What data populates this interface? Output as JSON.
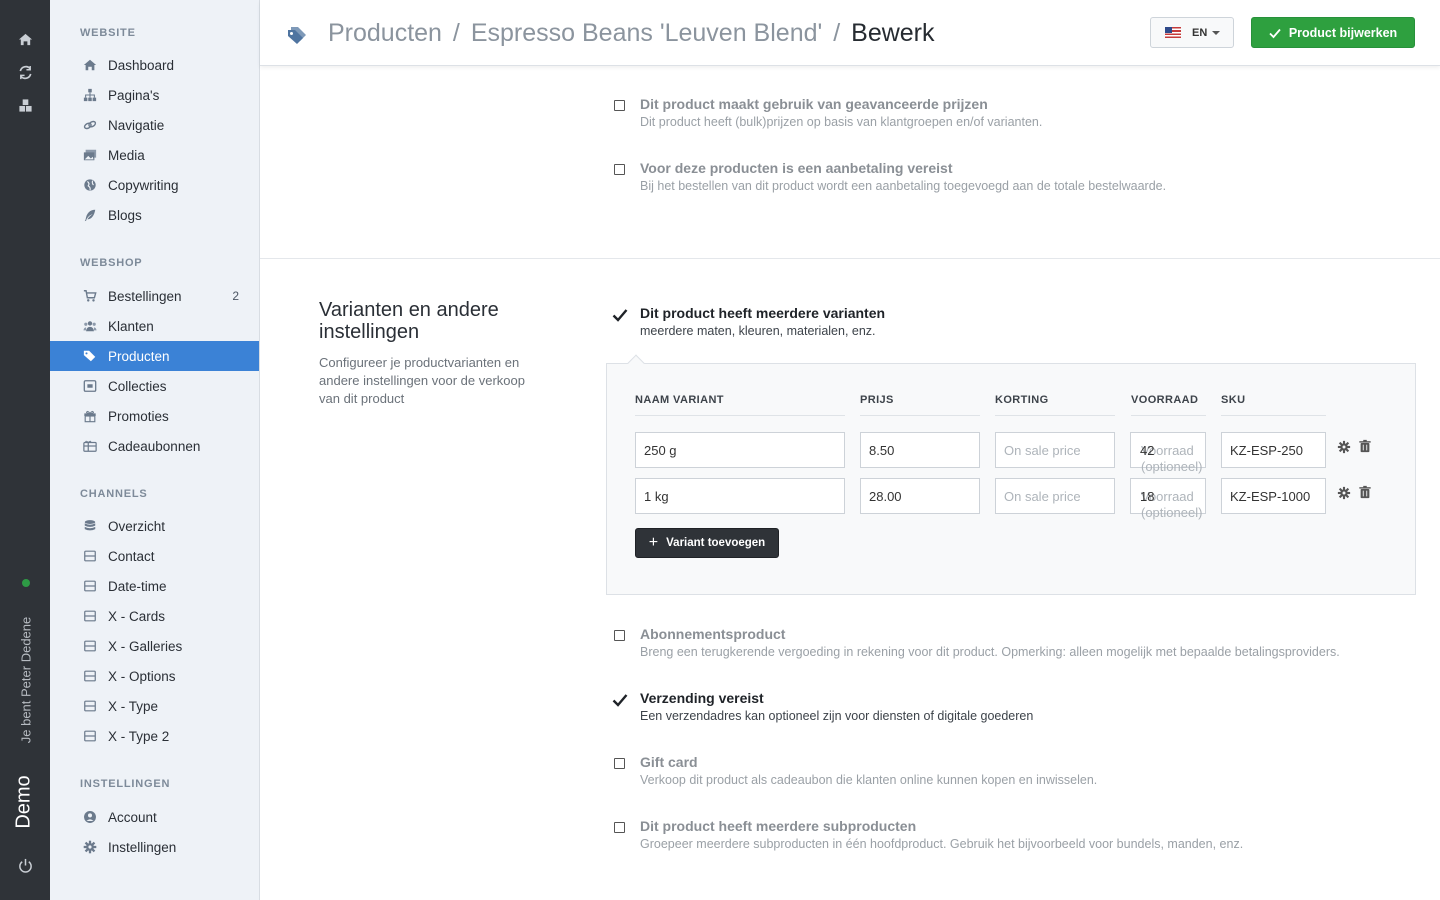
{
  "rail": {
    "user_label": "Je bent Peter Dedene",
    "brand": "Demo"
  },
  "sidebar": {
    "sections": [
      {
        "title": "WEBSITE",
        "items": [
          {
            "label": "Dashboard",
            "icon": "home-icon"
          },
          {
            "label": "Pagina's",
            "icon": "sitemap-icon"
          },
          {
            "label": "Navigatie",
            "icon": "link-icon"
          },
          {
            "label": "Media",
            "icon": "images-icon"
          },
          {
            "label": "Copywriting",
            "icon": "globe-icon"
          },
          {
            "label": "Blogs",
            "icon": "feather-icon"
          }
        ]
      },
      {
        "title": "WEBSHOP",
        "items": [
          {
            "label": "Bestellingen",
            "icon": "cart-icon",
            "badge": "2"
          },
          {
            "label": "Klanten",
            "icon": "users-icon"
          },
          {
            "label": "Producten",
            "icon": "tags-icon",
            "active": true
          },
          {
            "label": "Collecties",
            "icon": "collection-icon"
          },
          {
            "label": "Promoties",
            "icon": "gift-icon"
          },
          {
            "label": "Cadeaubonnen",
            "icon": "giftcard-icon"
          }
        ]
      },
      {
        "title": "CHANNELS",
        "items": [
          {
            "label": "Overzicht",
            "icon": "database-icon"
          },
          {
            "label": "Contact",
            "icon": "channel-icon"
          },
          {
            "label": "Date-time",
            "icon": "channel-icon"
          },
          {
            "label": "X - Cards",
            "icon": "channel-icon"
          },
          {
            "label": "X - Galleries",
            "icon": "channel-icon"
          },
          {
            "label": "X - Options",
            "icon": "channel-icon"
          },
          {
            "label": "X - Type",
            "icon": "channel-icon"
          },
          {
            "label": "X - Type 2",
            "icon": "channel-icon"
          }
        ]
      },
      {
        "title": "INSTELLINGEN",
        "items": [
          {
            "label": "Account",
            "icon": "user-circle-icon"
          },
          {
            "label": "Instellingen",
            "icon": "gear-icon"
          }
        ]
      }
    ]
  },
  "header": {
    "crumb1": "Producten",
    "crumb2": "Espresso Beans 'Leuven Blend'",
    "crumb3": "Bewerk",
    "separator": "/",
    "lang": "EN",
    "save_label": "Product bijwerken"
  },
  "options_top": [
    {
      "title": "Dit product maakt gebruik van geavanceerde prijzen",
      "desc": "Dit product heeft (bulk)prijzen op basis van klantgroepen en/of varianten.",
      "checked": false
    },
    {
      "title": "Voor deze producten is een aanbetaling vereist",
      "desc": "Bij het bestellen van dit product wordt een aanbetaling toegevoegd aan de totale bestelwaarde.",
      "checked": false
    }
  ],
  "section": {
    "heading": "Varianten en andere instellingen",
    "description": "Configureer je productvarianten en andere instellingen voor de verkoop van dit product"
  },
  "variants_toggle": {
    "title": "Dit product heeft meerdere varianten",
    "desc": "meerdere maten, kleuren, materialen, enz.",
    "checked": true
  },
  "variants": {
    "columns": [
      "NAAM VARIANT",
      "PRIJS",
      "KORTING",
      "VOORRAAD",
      "SKU"
    ],
    "discount_placeholder": "On sale price",
    "stock_placeholder_1": "Voorraad",
    "stock_placeholder_2": "(optioneel)",
    "rows": [
      {
        "name": "250 g",
        "price": "8.50",
        "stock": "42",
        "sku": "KZ-ESP-250"
      },
      {
        "name": "1 kg",
        "price": "28.00",
        "stock": "18",
        "sku": "KZ-ESP-1000"
      }
    ],
    "add_label": "Variant toevoegen"
  },
  "options_bottom": [
    {
      "title": "Abonnementsproduct",
      "desc": "Breng een terugkerende vergoeding in rekening voor dit product. Opmerking: alleen mogelijk met bepaalde betalingsproviders.",
      "checked": false
    },
    {
      "title": "Verzending vereist",
      "desc": "Een verzendadres kan optioneel zijn voor diensten of digitale goederen",
      "checked": true
    },
    {
      "title": "Gift card",
      "desc": "Verkoop dit product als cadeaubon die klanten online kunnen kopen en inwisselen.",
      "checked": false
    },
    {
      "title": "Dit product heeft meerdere subproducten",
      "desc": "Groepeer meerdere subproducten in één hoofdproduct. Gebruik het bijvoorbeeld voor bundels, manden, enz.",
      "checked": false
    }
  ]
}
